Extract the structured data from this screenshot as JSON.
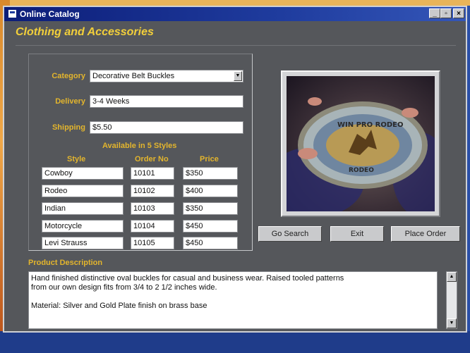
{
  "window": {
    "title": "Online Catalog",
    "icon": "app-icon"
  },
  "heading": "Clothing and Accessories",
  "form": {
    "category_label": "Category",
    "category_value": "Decorative Belt Buckles",
    "delivery_label": "Delivery",
    "delivery_value": "3-4 Weeks",
    "shipping_label": "Shipping",
    "shipping_value": "$5.50",
    "styles_heading": "Available in 5 Styles",
    "col_style": "Style",
    "col_order": "Order No",
    "col_price": "Price",
    "rows": [
      {
        "style": "Cowboy",
        "order": "10101",
        "price": "$350"
      },
      {
        "style": "Rodeo",
        "order": "10102",
        "price": "$400"
      },
      {
        "style": "Indian",
        "order": "10103",
        "price": "$350"
      },
      {
        "style": "Motorcycle",
        "order": "10104",
        "price": "$450"
      },
      {
        "style": "Levi Strauss",
        "order": "10105",
        "price": "$450"
      }
    ]
  },
  "buttons": {
    "search": "Go Search",
    "exit": "Exit",
    "order": "Place Order"
  },
  "description": {
    "label": "Product Description",
    "line1": "Hand finished distinctive oval buckles for casual and business wear. Raised tooled patterns",
    "line2": "from our own design fits from 3/4 to 2 1/2 inches wide.",
    "line3": "Material: Silver and Gold Plate finish on brass base"
  },
  "photo": {
    "buckle_text_top": "WIN PRO RODEO",
    "buckle_text_bottom": "RODEO"
  },
  "colors": {
    "accent": "#e3b52d",
    "title_bar": "#0c1d78",
    "panel": "#55575b"
  }
}
